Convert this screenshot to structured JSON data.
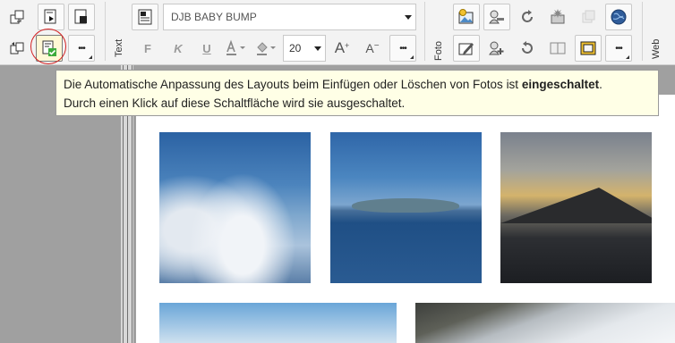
{
  "toolbar": {
    "font_name": "DJB BABY BUMP",
    "font_size": "20",
    "text_group_label": "Text",
    "photo_group_label": "Foto",
    "web_group_label": "Web",
    "bold_label": "F",
    "italic_label": "K",
    "underline_label": "U",
    "font_increase_label": "A",
    "font_decrease_label": "A",
    "more_label": "•••",
    "highlighted_button": "auto-layout-adjust-button"
  },
  "tooltip": {
    "line1_before": "Die Automatische Anpassung des Layouts beim Einfügen oder Löschen von Fotos ist ",
    "line1_bold": "eingeschaltet",
    "line1_after": ".",
    "line2": "Durch einen Klick auf diese Schaltfläche wird sie ausgeschaltet."
  },
  "colors": {
    "toolbar_bg": "#f3f3f3",
    "tooltip_bg": "#ffffe6",
    "workspace_bg": "#a0a0a0",
    "annotation_ring": "#d42020",
    "check_green": "#3cab3c"
  },
  "photos": [
    "aerial-clouds",
    "island-sea",
    "mountain-sunset",
    "sky-horizon",
    "rocky-coast"
  ]
}
